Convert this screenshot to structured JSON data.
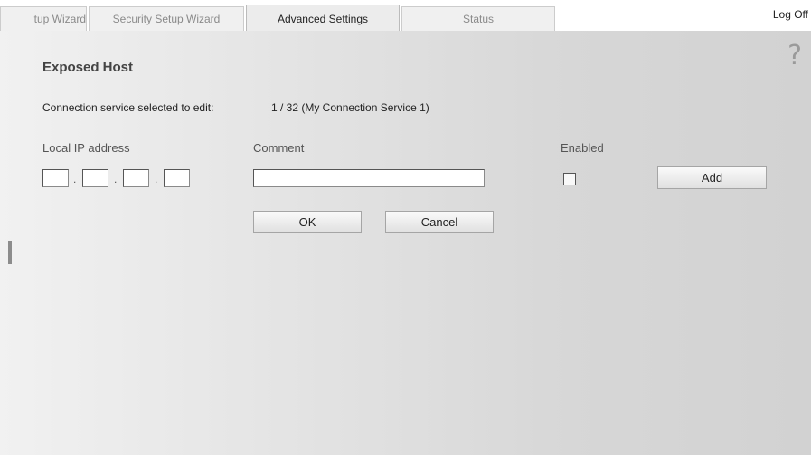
{
  "tabs": [
    {
      "label": "tup Wizard"
    },
    {
      "label": "Security Setup Wizard"
    },
    {
      "label": "Advanced Settings",
      "active": true
    },
    {
      "label": "Status"
    }
  ],
  "logoff": "Log Off",
  "help_glyph": "?",
  "page": {
    "title": "Exposed Host",
    "connection_label": "Connection service selected to edit:",
    "connection_value": "1 / 32 (My Connection Service 1)"
  },
  "table": {
    "col_ip": "Local IP address",
    "col_comment": "Comment",
    "col_enabled": "Enabled",
    "ip_separator": ".",
    "ip_values": [
      "",
      "",
      "",
      ""
    ],
    "comment_value": "",
    "enabled": false
  },
  "buttons": {
    "add": "Add",
    "ok": "OK",
    "cancel": "Cancel"
  }
}
